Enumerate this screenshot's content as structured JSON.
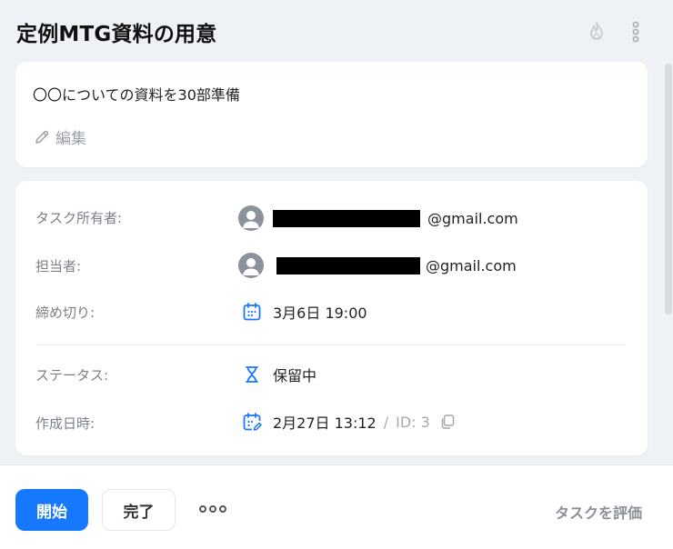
{
  "header": {
    "title": "定例MTG資料の用意"
  },
  "description": {
    "text": "〇〇についての資料を30部準備",
    "edit_label": "編集"
  },
  "details": {
    "owner": {
      "label": "タスク所有者:",
      "email_suffix": "@gmail.com"
    },
    "assignee": {
      "label": "担当者:",
      "email_suffix": "@gmail.com"
    },
    "deadline": {
      "label": "締め切り:",
      "value": "3月6日 19:00"
    },
    "status": {
      "label": "ステータス:",
      "value": "保留中"
    },
    "created": {
      "label": "作成日時:",
      "value": "2月27日 13:12",
      "separator": "/",
      "id_text": "ID: 3"
    }
  },
  "footer": {
    "start_label": "開始",
    "done_label": "完了",
    "rate_label": "タスクを評価"
  },
  "colors": {
    "accent": "#1677ff",
    "background": "#eef1f5"
  },
  "icons": [
    "flame-icon",
    "kebab-menu-icon",
    "pencil-icon",
    "user-avatar-icon",
    "calendar-icon",
    "hourglass-icon",
    "calendar-edit-icon",
    "copy-icon",
    "more-icon"
  ]
}
